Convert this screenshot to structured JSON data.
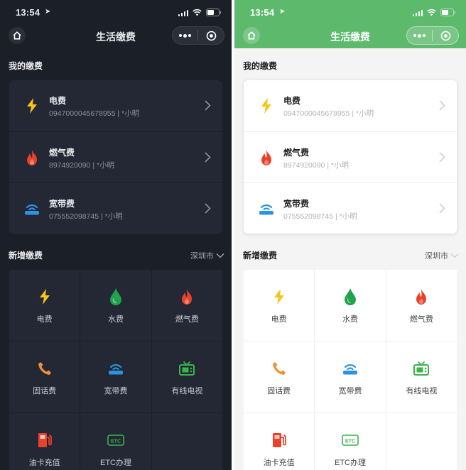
{
  "status": {
    "time": "13:54"
  },
  "nav": {
    "title": "生活缴费"
  },
  "my_bills": {
    "title": "我的缴费",
    "items": [
      {
        "name": "电费",
        "account": "0947000045678955 | *小明",
        "icon": "lightning-icon",
        "color": "#f5c518"
      },
      {
        "name": "燃气费",
        "account": "8974920090 | *小明",
        "icon": "flame-icon",
        "color": "#e8422b"
      },
      {
        "name": "宽带费",
        "account": "075552098745 | *小明",
        "icon": "broadband-icon",
        "color": "#2b93e3"
      }
    ]
  },
  "new_bills": {
    "title": "新增缴费",
    "city": "深圳市",
    "items": [
      {
        "label": "电费",
        "icon": "lightning-icon",
        "color": "#f5c518"
      },
      {
        "label": "水费",
        "icon": "water-drop-icon",
        "color": "#20a34a"
      },
      {
        "label": "燃气费",
        "icon": "flame-icon",
        "color": "#e8422b"
      },
      {
        "label": "固话费",
        "icon": "phone-icon",
        "color": "#f0913a"
      },
      {
        "label": "宽带费",
        "icon": "broadband-icon",
        "color": "#2b93e3"
      },
      {
        "label": "有线电视",
        "icon": "tv-icon",
        "color": "#3bb34a"
      },
      {
        "label": "油卡充值",
        "icon": "fuel-icon",
        "color": "#e8422b"
      },
      {
        "label": "ETC办理",
        "icon": "etc-icon",
        "color": "#3bb34a"
      },
      {
        "label": "",
        "icon": "",
        "color": ""
      }
    ]
  },
  "themes": {
    "dark": {
      "background": "#1b1f27",
      "card": "#232834",
      "text": "#e8e9eb"
    },
    "light": {
      "header": "#5dba6d",
      "background": "#f4f4f4",
      "card": "#ffffff",
      "text": "#222222"
    }
  }
}
